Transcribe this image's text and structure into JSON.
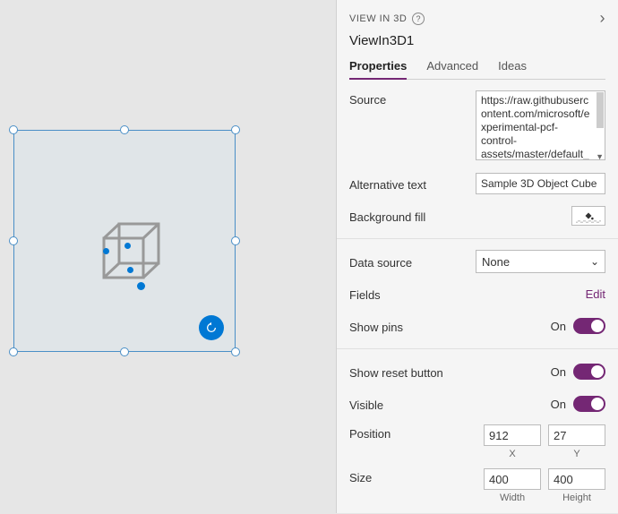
{
  "header": {
    "view_caption": "VIEW IN 3D",
    "object_name": "ViewIn3D1"
  },
  "tabs": {
    "properties": "Properties",
    "advanced": "Advanced",
    "ideas": "Ideas"
  },
  "props": {
    "source_label": "Source",
    "source_value": "https://raw.githubusercontent.com/microsoft/experimental-pcf-control-assets/master/default_",
    "alt_label": "Alternative text",
    "alt_value": "Sample 3D Object Cube",
    "bgfill_label": "Background fill",
    "datasource_label": "Data source",
    "datasource_value": "None",
    "fields_label": "Fields",
    "fields_action": "Edit",
    "showpins_label": "Show pins",
    "showpins_state": "On",
    "showreset_label": "Show reset button",
    "showreset_state": "On",
    "visible_label": "Visible",
    "visible_state": "On",
    "position_label": "Position",
    "position_x": "912",
    "position_y": "27",
    "position_x_caption": "X",
    "position_y_caption": "Y",
    "size_label": "Size",
    "size_w": "400",
    "size_h": "400",
    "size_w_caption": "Width",
    "size_h_caption": "Height"
  }
}
